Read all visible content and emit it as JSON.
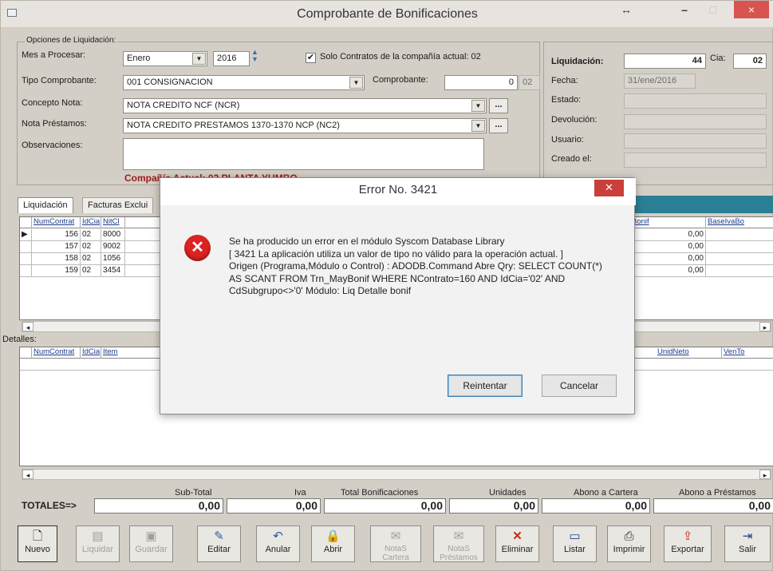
{
  "window": {
    "title": "Comprobante de Bonificaciones",
    "btn_resize": "↔",
    "btn_min": "–",
    "btn_max": "□",
    "btn_close": "×"
  },
  "options": {
    "group_label": "Opciones de Liquidación:",
    "mes_label": "Mes a Procesar:",
    "mes_value": "Enero",
    "year_value": "2016",
    "solo_contratos_label": "Solo Contratos de la compañía actual: 02",
    "solo_contratos_checked": true,
    "tipo_label": "Tipo Comprobante:",
    "tipo_value": "001  CONSIGNACION",
    "comprobante_label": "Comprobante:",
    "comprobante_value": "0",
    "comprobante_code": "02",
    "concepto_label": "Concepto Nota:",
    "concepto_value": "NOTA CREDITO NCF  (NCR)",
    "prestamos_label": "Nota Préstamos:",
    "prestamos_value": "NOTA CREDITO PRESTAMOS 1370-1370 NCP  (NC2)",
    "ellipsis": "...",
    "obs_label": "Observaciones:",
    "obs_value": "",
    "company_text": "Compañía Actual: 02 PLANTA YUMBO"
  },
  "liquidacion": {
    "label": "Liquidación:",
    "value": "44",
    "cia_label": "Cia:",
    "cia_value": "02",
    "fecha_label": "Fecha:",
    "fecha_value": "31/ene/2016",
    "estado_label": "Estado:",
    "devolucion_label": "Devolución:",
    "usuario_label": "Usuario:",
    "creado_label": "Creado el:"
  },
  "tabs": [
    {
      "label": "Liquidación"
    },
    {
      "label": "Facturas Exclui"
    }
  ],
  "grid_main": {
    "headers": [
      "NumContrat",
      "IdCia",
      "NitCl"
    ],
    "right_headers": [
      "Bonif",
      "BaseIvaBo"
    ],
    "rows": [
      {
        "marker": "▶",
        "num": "156",
        "cia": "02",
        "nit": "8000",
        "bonif": "0,00"
      },
      {
        "marker": "",
        "num": "157",
        "cia": "02",
        "nit": "9002",
        "bonif": "0,00"
      },
      {
        "marker": "",
        "num": "158",
        "cia": "02",
        "nit": "1056",
        "bonif": "0,00"
      },
      {
        "marker": "",
        "num": "159",
        "cia": "02",
        "nit": "3454",
        "bonif": "0,00"
      }
    ]
  },
  "detalles": {
    "label": "Detalles:",
    "headers": [
      "NumContrat",
      "IdCia",
      "Item"
    ],
    "right_headers": [
      "UnidNeto",
      "VenTo"
    ]
  },
  "scroll": {
    "left": "◂",
    "right": "▸"
  },
  "totals": {
    "label": "TOTALES=>",
    "cols": [
      {
        "header": "Sub-Total",
        "value": "0,00"
      },
      {
        "header": "Iva",
        "value": "0,00"
      },
      {
        "header": "Total Bonificaciones",
        "value": "0,00"
      },
      {
        "header": "Unidades",
        "value": "0,00"
      },
      {
        "header": "Abono a Cartera",
        "value": "0,00"
      },
      {
        "header": "Abono a Préstamos",
        "value": "0,00"
      }
    ]
  },
  "toolbar": [
    {
      "label": "Nuevo",
      "icon": "new-doc-icon",
      "glyph": "🗋"
    },
    {
      "label": "Liquidar",
      "icon": "calculator-icon",
      "glyph": "▤"
    },
    {
      "label": "Guardar",
      "icon": "save-icon",
      "glyph": "▣"
    },
    {
      "label": "Editar",
      "icon": "edit-icon",
      "glyph": "✎"
    },
    {
      "label": "Anular",
      "icon": "undo-icon",
      "glyph": "↶"
    },
    {
      "label": "Abrir",
      "icon": "lock-icon",
      "glyph": "🔒"
    },
    {
      "label": "NotaS Cartera",
      "icon": "note-icon",
      "glyph": "✉"
    },
    {
      "label": "NotaS Préstamos",
      "icon": "note-icon",
      "glyph": "✉"
    },
    {
      "label": "Eliminar",
      "icon": "delete-x-icon",
      "glyph": "✕"
    },
    {
      "label": "Listar",
      "icon": "list-window-icon",
      "glyph": "▭"
    },
    {
      "label": "Imprimir",
      "icon": "printer-icon",
      "glyph": "⎙"
    },
    {
      "label": "Exportar",
      "icon": "export-icon",
      "glyph": "⇪"
    },
    {
      "label": "Salir",
      "icon": "exit-door-icon",
      "glyph": "⇥"
    }
  ],
  "dialog": {
    "title": "Error No. 3421",
    "close": "✕",
    "message": "Se ha producido un error en el módulo Syscom Database Library\n[ 3421  La aplicación utiliza un valor de tipo no válido para la operación actual. ]\n Origen (Programa,Módulo o Control) : ADODB.Command Abre Qry: SELECT COUNT(*) AS SCANT FROM Trn_MayBonif WHERE NContrato=160 AND IdCia='02' AND CdSubgrupo<>'0' Módulo: Liq Detalle bonif",
    "retry_label": "Reintentar",
    "cancel_label": "Cancelar"
  }
}
